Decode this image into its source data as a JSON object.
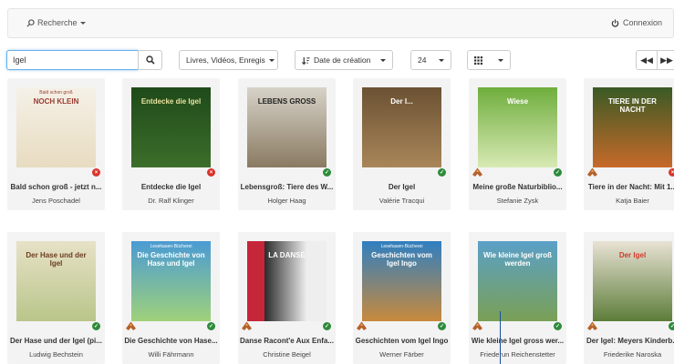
{
  "header": {
    "search_label": "Recherche",
    "login_label": "Connexion"
  },
  "toolbar": {
    "search_value": "Igel",
    "media_filter": "Livres, Vidéos, Enregis",
    "sort_label": "Date de création",
    "per_page": "24"
  },
  "books": [
    {
      "title": "Bald schon groß - jetzt n...",
      "author": "Jens Poschadel",
      "status": "unavailable"
    },
    {
      "title": "Entdecke die Igel",
      "author": "Dr. Ralf Klinger",
      "status": "unavailable"
    },
    {
      "title": "Lebensgroß: Tiere des W...",
      "author": "Holger Haag",
      "status": "available"
    },
    {
      "title": "Der Igel",
      "author": "Valérie Tracqui",
      "status": "available"
    },
    {
      "title": "Meine große Naturbiblio...",
      "author": "Stefanie Zysk",
      "status": "available"
    },
    {
      "title": "Tiere in der Nacht: Mit 1...",
      "author": "Katja Baier",
      "status": "unavailable"
    },
    {
      "title": "Der Hase und der Igel (pi...",
      "author": "Ludwig Bechstein",
      "status": "available"
    },
    {
      "title": "Die Geschichte von Hase...",
      "author": "Willi Fährmann",
      "status": "available"
    },
    {
      "title": "Danse Racont'e Aux Enfa...",
      "author": "Christine Beigel",
      "status": "available"
    },
    {
      "title": "Geschichten vom Igel Ingo",
      "author": "Werner Färber",
      "status": "available"
    },
    {
      "title": "Wie kleine Igel gross wer...",
      "author": "Friederun Reichenstetter",
      "status": "available"
    },
    {
      "title": "Der Igel: Meyers Kinderb...",
      "author": "Friederike Naroska",
      "status": "available"
    }
  ],
  "covers": [
    {
      "text": "NOCH KLEIN",
      "caption": "Bald schon groß"
    },
    {
      "text": "Entdecke die Igel",
      "caption": ""
    },
    {
      "text": "LEBENS GROSS",
      "caption": ""
    },
    {
      "text": "Der I...",
      "caption": ""
    },
    {
      "text": "Wiese",
      "caption": ""
    },
    {
      "text": "TIERE IN DER NACHT",
      "caption": ""
    },
    {
      "text": "Der Hase und der Igel",
      "caption": ""
    },
    {
      "text": "Die Geschichte von Hase und Igel",
      "caption": "Lesehasen-Bücherei"
    },
    {
      "text": "LA DANSE",
      "caption": ""
    },
    {
      "text": "Geschichten vom Igel Ingo",
      "caption": "Lesehasen-Bücherei"
    },
    {
      "text": "Wie kleine Igel groß werden",
      "caption": ""
    },
    {
      "text": "Der Igel",
      "caption": ""
    }
  ],
  "colors": {
    "accent": "#66afe9",
    "available": "#2e8b3b",
    "unavailable": "#d9342b"
  }
}
